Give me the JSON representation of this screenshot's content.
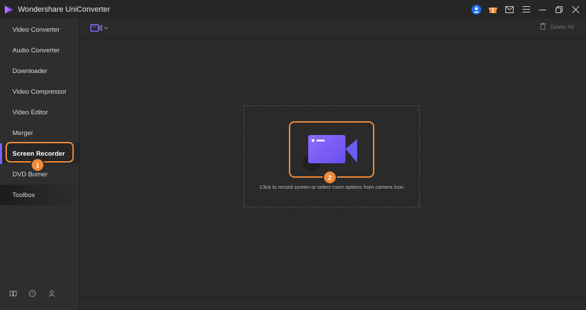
{
  "app": {
    "title": "Wondershare UniConverter"
  },
  "sidebar": {
    "items": [
      {
        "label": "Video Converter"
      },
      {
        "label": "Audio Converter"
      },
      {
        "label": "Downloader"
      },
      {
        "label": "Video Compressor"
      },
      {
        "label": "Video Editor"
      },
      {
        "label": "Merger"
      },
      {
        "label": "Screen Recorder",
        "active": true
      },
      {
        "label": "DVD Burner"
      },
      {
        "label": "Toolbox"
      }
    ]
  },
  "toolbar": {
    "delete_all_label": "Delete All"
  },
  "main": {
    "hint": "Click to record screen or select more options from camera icon"
  },
  "badges": {
    "one": "1",
    "two": "2"
  },
  "colors": {
    "accent": "#7b61ff",
    "highlight": "#f08a3a",
    "avatar": "#1e6ef0"
  },
  "icons": [
    "app-logo-icon",
    "user-avatar-icon",
    "gift-icon",
    "mail-icon",
    "menu-icon",
    "minimize-icon",
    "restore-icon",
    "close-icon",
    "camera-dropdown-icon",
    "trash-icon",
    "video-camera-icon",
    "book-icon",
    "help-icon",
    "account-icon"
  ]
}
